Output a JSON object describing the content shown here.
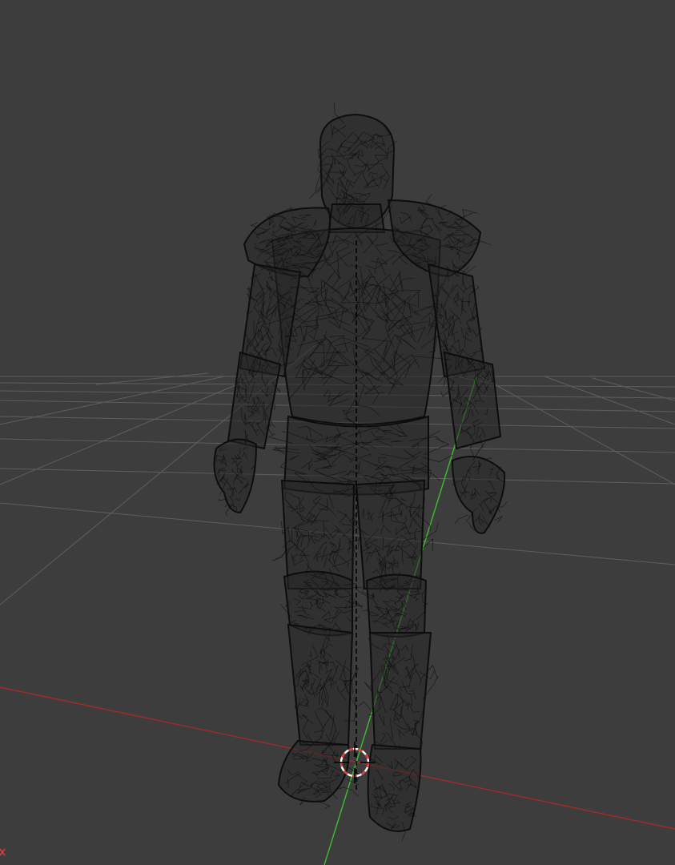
{
  "app": {
    "viewport_mode": "wireframe",
    "colors": {
      "background": "#3d3d3d",
      "grid": "#5f5f5f",
      "mesh": "#111111",
      "x_axis": "#a52a2a",
      "y_axis": "#3bbf2f",
      "cursor_red": "#e03a3a",
      "cursor_white": "#ffffff"
    }
  },
  "scene": {
    "object_type": "armored-character-mesh",
    "cursor": "3d-cursor-icon",
    "origin_axis": "vertical-origin-axis"
  },
  "overlay": {
    "corner_text": ""
  }
}
